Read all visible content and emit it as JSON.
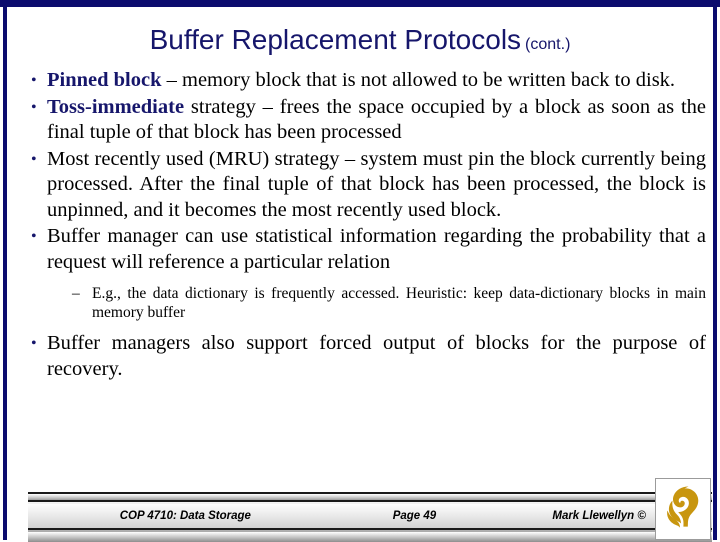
{
  "slide": {
    "title": "Buffer Replacement Protocols",
    "title_suffix": "(cont.)",
    "accent_color": "#16166b",
    "logo_color": "#c8960f",
    "bullet_marker": "•",
    "sub_bullet_marker": "–",
    "bullets": [
      {
        "lead": "Pinned block",
        "text": " – memory block that is not allowed to be written back to disk."
      },
      {
        "lead": "Toss-immediate",
        "text": " strategy – frees the space occupied by a block as soon as the final tuple of that block has been processed"
      },
      {
        "lead": "",
        "text": "Most recently used (MRU) strategy –  system must pin the block currently being processed.  After the final tuple of that block has been processed, the block is unpinned, and it becomes the most recently used block."
      },
      {
        "lead": "",
        "text": "Buffer manager can use statistical information regarding the probability that a request will reference a particular relation"
      }
    ],
    "sub_bullets": [
      {
        "text": "E.g., the data dictionary is frequently accessed.   Heuristic:   keep data-dictionary blocks in main memory buffer"
      }
    ],
    "bullets_after": [
      {
        "lead": "",
        "text": "Buffer managers also support forced output of blocks for the purpose of recovery."
      }
    ]
  },
  "footer": {
    "course": "COP 4710: Data Storage",
    "page": "Page 49",
    "author": "Mark Llewellyn ©"
  }
}
